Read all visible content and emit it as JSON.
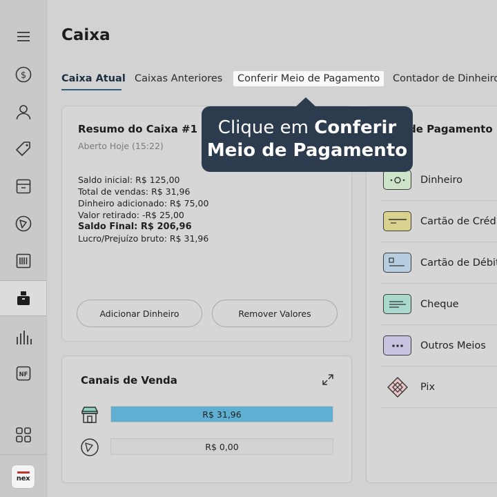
{
  "sidebar": {
    "items": [
      {
        "icon": "menu-icon"
      },
      {
        "icon": "dollar-circle-icon"
      },
      {
        "icon": "user-icon"
      },
      {
        "icon": "tag-icon"
      },
      {
        "icon": "store-icon"
      },
      {
        "icon": "delivery-icon"
      },
      {
        "icon": "barcode-icon"
      },
      {
        "icon": "cash-register-icon",
        "active": true
      },
      {
        "icon": "bar-chart-icon"
      },
      {
        "icon": "nf-document-icon",
        "label": "NF"
      },
      {
        "icon": "apps-grid-icon"
      }
    ],
    "logo_text": "nex"
  },
  "page": {
    "title": "Caixa"
  },
  "tabs": [
    {
      "label": "Caixa Atual",
      "active": true
    },
    {
      "label": "Caixas Anteriores"
    },
    {
      "label": "Conferir Meio de Pagamento",
      "highlighted": true
    },
    {
      "label": "Contador de Dinheiro"
    }
  ],
  "summary": {
    "title": "Resumo do Caixa #1",
    "subtitle": "Aberto Hoje (15:22)",
    "lines": {
      "saldo_inicial": "Saldo inicial: R$ 125,00",
      "total_vendas": "Total de vendas: R$ 31,96",
      "dinheiro_adicionado": "Dinheiro adicionado: R$ 75,00",
      "valor_retirado": "Valor retirado: -R$ 25,00",
      "saldo_final": "Saldo Final: R$ 206,96",
      "lucro": "Lucro/Prejuízo bruto: R$ 31,96"
    },
    "add_button": "Adicionar Dinheiro",
    "remove_button": "Remover Valores"
  },
  "channels": {
    "title": "Canais de Venda",
    "rows": [
      {
        "icon": "store-icon",
        "value": "R$ 31,96",
        "fill": 1.0
      },
      {
        "icon": "delivery-icon",
        "value": "R$ 0,00",
        "fill": 0.0
      }
    ]
  },
  "payments": {
    "title": "de Pagamento",
    "items": [
      {
        "label": "Dinheiro",
        "icon": "cash-icon",
        "color": "#cfe3c8"
      },
      {
        "label": "Cartão de Créd",
        "icon": "credit-card-icon",
        "color": "#d9d28e"
      },
      {
        "label": "Cartão de Débit",
        "icon": "debit-card-icon",
        "color": "#b7cde0"
      },
      {
        "label": "Cheque",
        "icon": "cheque-icon",
        "color": "#a9d8cc"
      },
      {
        "label": "Outros Meios",
        "icon": "dots-icon",
        "color": "#c9c2e0"
      },
      {
        "label": "Pix",
        "icon": "pix-icon",
        "color": "#e8c6c6"
      }
    ]
  },
  "tooltip": {
    "line1_normal": "Clique em ",
    "line1_bold": "Conferir",
    "line2_bold": "Meio de Pagamento"
  },
  "colors": {
    "accent": "#2e5d7e",
    "tooltip_bg": "#2c3c4e",
    "bar_fill": "#5fafd2"
  }
}
